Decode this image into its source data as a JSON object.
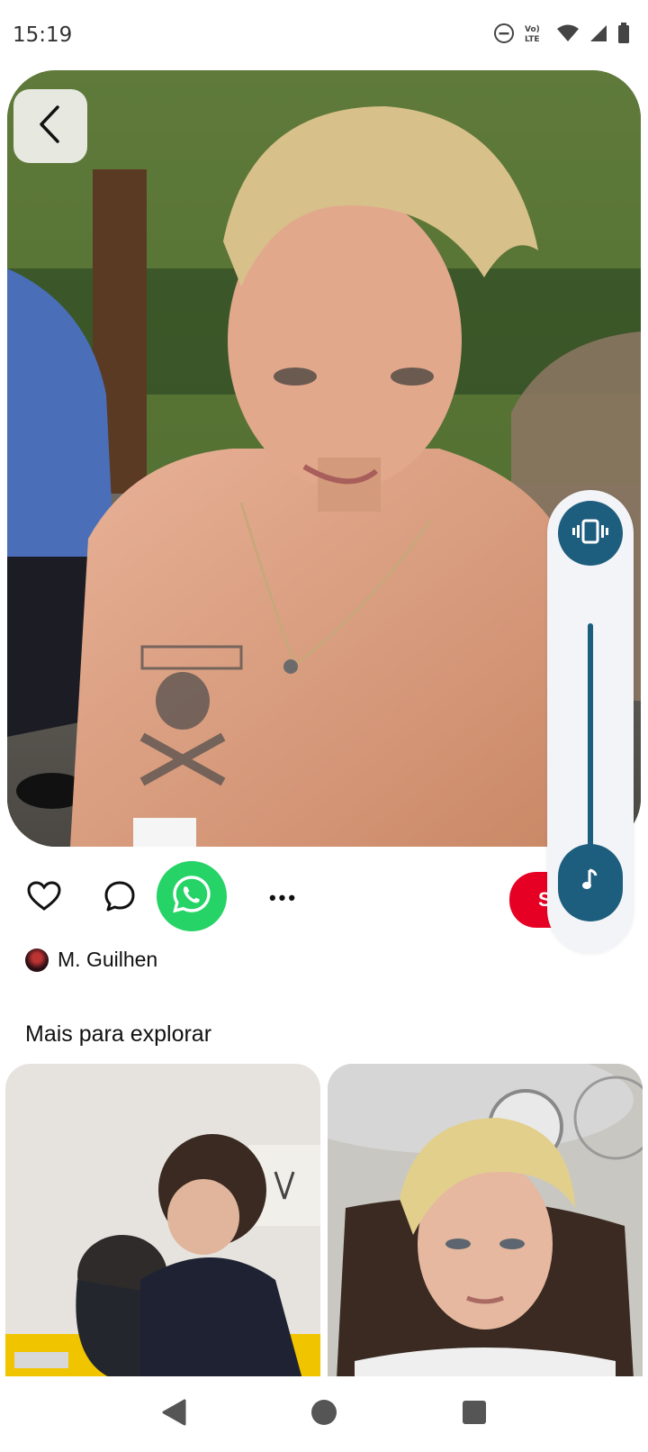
{
  "status_bar": {
    "time": "15:19",
    "icons": [
      "do-not-disturb-icon",
      "volte-icon",
      "wifi-icon",
      "signal-icon",
      "battery-icon"
    ]
  },
  "pin": {
    "image_description": "pin-photo",
    "back_icon": "chevron-left-icon"
  },
  "volume_panel": {
    "vibrate_icon": "vibrate-icon",
    "knob_icon": "music-note-icon",
    "level": 0.05,
    "more_label": "•••"
  },
  "actions": {
    "like_icon": "heart-icon",
    "comment_icon": "comment-icon",
    "share_icon": "whatsapp-icon",
    "more_label": "•••",
    "save_label": "S"
  },
  "author": {
    "name": "M. Guilhen"
  },
  "explore": {
    "title": "Mais para explorar"
  },
  "nav": {
    "back_icon": "triangle-back-icon",
    "home_icon": "circle-home-icon",
    "recents_icon": "square-recents-icon"
  },
  "colors": {
    "accent": "#1d5d7d",
    "save_red": "#e60023",
    "whatsapp_green": "#25d366"
  }
}
